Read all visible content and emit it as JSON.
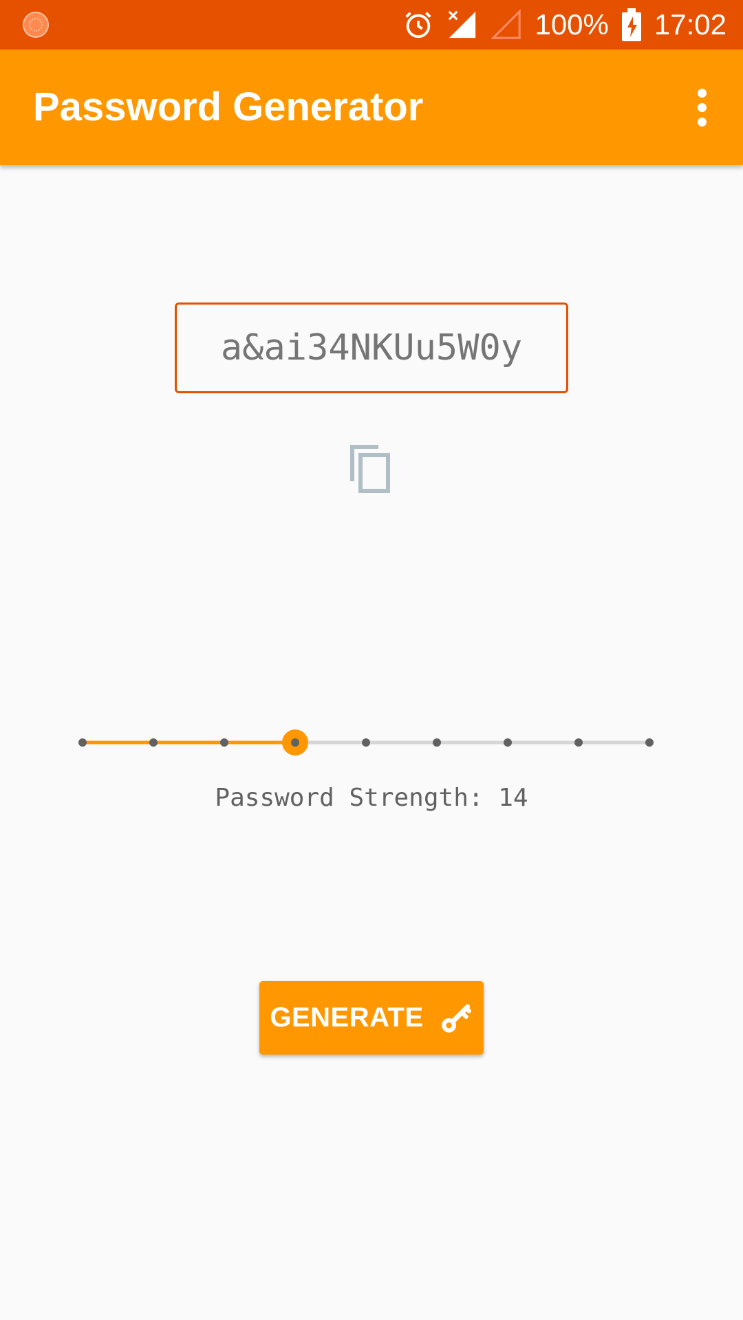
{
  "status_bar": {
    "battery": "100%",
    "time": "17:02",
    "icons": [
      "notification-icon",
      "alarm-icon",
      "signal-no-data-icon",
      "signal-empty-icon",
      "battery-charging-icon"
    ]
  },
  "app_bar": {
    "title": "Password Generator",
    "menu_icon": "more-vert-icon"
  },
  "password": {
    "value": "a&ai34NKUu5W0y",
    "copy_icon": "copy-icon"
  },
  "slider": {
    "steps": 9,
    "selected_index": 3
  },
  "strength_label": "Password Strength: 14",
  "generate_button": {
    "label": "GENERATE",
    "icon": "key-icon"
  },
  "colors": {
    "status_bar": "#e65100",
    "app_bar": "#ff9800",
    "accent": "#ff9800",
    "border": "#e65100"
  }
}
